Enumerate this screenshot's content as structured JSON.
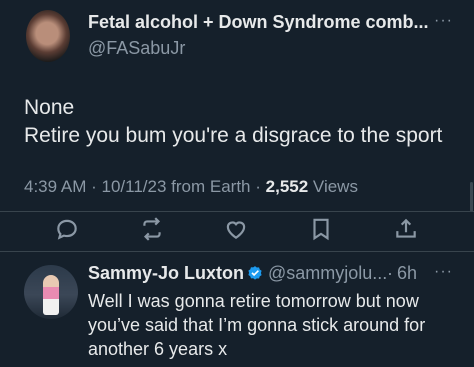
{
  "main_tweet": {
    "author_name": "Fetal alcohol + Down Syndrome comb...",
    "author_handle": "@FASabuJr",
    "more": "···",
    "text_line1": "None",
    "text_line2": "Retire you bum you're a disgrace to the sport",
    "time": "4:39 AM",
    "date": "10/11/23",
    "source": "from Earth",
    "views_count": "2,552",
    "views_label": "Views",
    "actions": [
      "reply-icon",
      "retweet-icon",
      "like-icon",
      "bookmark-icon",
      "share-icon"
    ]
  },
  "reply_tweet": {
    "author_name": "Sammy-Jo Luxton",
    "verified": true,
    "author_handle": "@sammyjolu...",
    "separator": "·",
    "time": "6h",
    "more": "···",
    "text_line1": "Well I was gonna retire tomorrow but now",
    "text_line2": "you’ve said that I’m gonna stick around for",
    "text_line3": "another 6 years x"
  },
  "colors": {
    "background": "#15202b",
    "text": "#e7e9ea",
    "muted": "#8b98a5",
    "verified": "#1d9bf0"
  }
}
